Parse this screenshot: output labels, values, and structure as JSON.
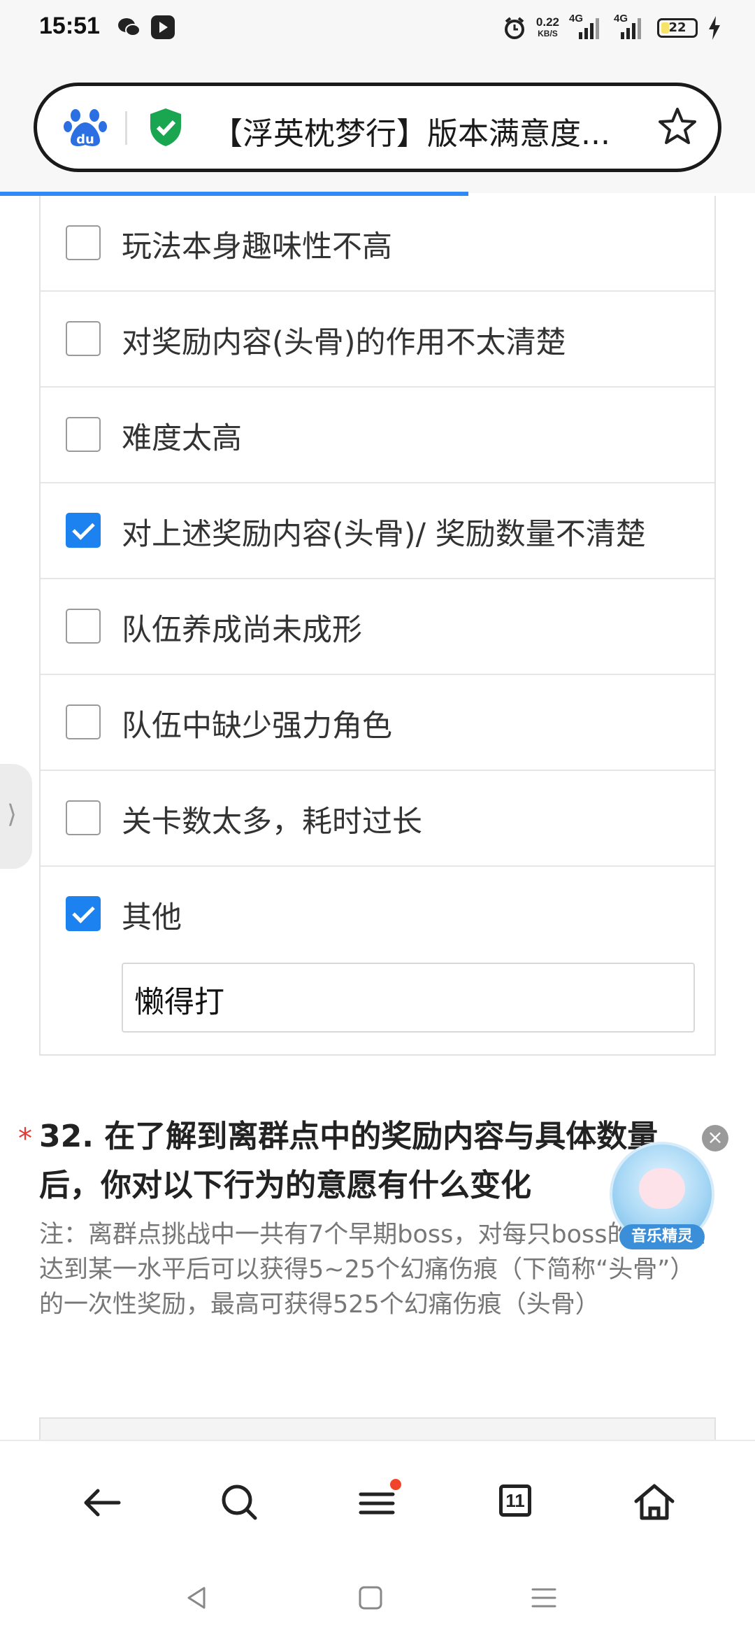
{
  "status_bar": {
    "time": "15:51",
    "speed_value": "0.22",
    "speed_unit": "KB/S",
    "net1": "4G",
    "net2": "4G",
    "battery_level": "22",
    "icons": [
      "wechat-icon",
      "tiktok-icon",
      "alarm-icon",
      "signal-icon",
      "battery-icon",
      "charging-icon"
    ]
  },
  "browser": {
    "page_title": "【浮英枕梦行】版本满意度..."
  },
  "options": [
    {
      "label": "玩法本身趣味性不高",
      "checked": false
    },
    {
      "label": "对奖励内容(头骨)的作用不太清楚",
      "checked": false
    },
    {
      "label": "难度太高",
      "checked": false
    },
    {
      "label": "对上述奖励内容(头骨)/ 奖励数量不清楚",
      "checked": true
    },
    {
      "label": "队伍养成尚未成形",
      "checked": false
    },
    {
      "label": "队伍中缺少强力角色",
      "checked": false
    },
    {
      "label": "关卡数太多，耗时过长",
      "checked": false
    }
  ],
  "other_option": {
    "label": "其他",
    "checked": true,
    "value": "懒得打"
  },
  "question": {
    "required_mark": "*",
    "title": "32. 在了解到离群点中的奖励内容与具体数量后，你对以下行为的意愿有什么变化",
    "note": "注：离群点挑战中一共有7个早期boss，对每只boss的讨伐值达到某一水平后可以获得5~25个幻痛伤痕（下简称“头骨”）的一次性奖励，最高可获得525个幻痛伤痕（头骨）"
  },
  "floating_widget": {
    "label": "音乐精灵",
    "close": "×"
  },
  "toolbar": {
    "tab_count": "11"
  },
  "colors": {
    "accent": "#1b82f0",
    "required": "#e53935",
    "badge": "#f0452b",
    "progress": "#2f8af5"
  }
}
